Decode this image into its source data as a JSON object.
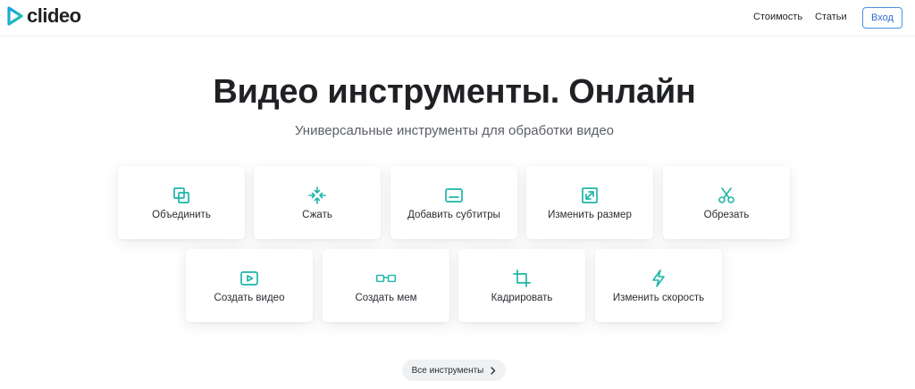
{
  "header": {
    "logo_text": "clideo",
    "nav": [
      {
        "label": "Стоимость"
      },
      {
        "label": "Статьи"
      }
    ],
    "login_label": "Вход"
  },
  "hero": {
    "title": "Видео инструменты. Онлайн",
    "subtitle": "Универсальные инструменты для обработки видео"
  },
  "tools": [
    {
      "label": "Объединить",
      "icon": "merge-icon"
    },
    {
      "label": "Сжать",
      "icon": "compress-icon"
    },
    {
      "label": "Добавить субтитры",
      "icon": "subtitles-icon"
    },
    {
      "label": "Изменить размер",
      "icon": "resize-icon"
    },
    {
      "label": "Обрезать",
      "icon": "scissors-icon"
    },
    {
      "label": "Создать видео",
      "icon": "play-icon"
    },
    {
      "label": "Создать мем",
      "icon": "glasses-icon"
    },
    {
      "label": "Кадрировать",
      "icon": "crop-icon"
    },
    {
      "label": "Изменить скорость",
      "icon": "lightning-icon"
    }
  ],
  "all_tools_label": "Все инструменты",
  "colors": {
    "accent": "#1fb5a8",
    "logo": "#1aa1e6",
    "login_border": "#4a90e2"
  }
}
